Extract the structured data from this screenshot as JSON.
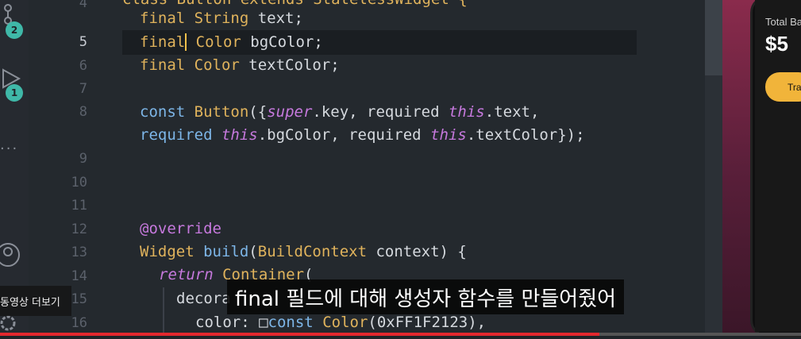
{
  "activity_bar": {
    "source_control_badge": "2",
    "run_badge": "1",
    "more_label": "..."
  },
  "line_numbers": [
    "4",
    "5",
    "6",
    "7",
    "8",
    "9",
    "10",
    "11",
    "12",
    "13",
    "14",
    "15",
    "16"
  ],
  "code": {
    "line4": {
      "kw": "final",
      "type": "String",
      "rest": " text;"
    },
    "line5": {
      "kw": "final",
      "type": "Color",
      "rest": " bgColor;"
    },
    "line6": {
      "kw": "final",
      "type": "Color",
      "rest": " textColor;"
    },
    "line8a": {
      "kw": "const",
      "cls": "Button",
      "p1": "({",
      "super": "super",
      "p2": ".key, required ",
      "this1": "this",
      "p3": ".text,"
    },
    "line8b": {
      "kw": "required ",
      "this2": "this",
      "p4": ".bgColor, required ",
      "this3": "this",
      "p5": ".textColor",
      "p6": "});"
    },
    "line12": {
      "ann": "@override"
    },
    "line13": {
      "type": "Widget",
      "fn": "build",
      "p1": "(",
      "type2": "BuildContext",
      "p2": " context) {"
    },
    "line14": {
      "kw": "return",
      "type": "Container",
      "p1": "("
    },
    "line15": {
      "text": "decora"
    },
    "line16": {
      "prop": "color: ",
      "swatch": "□",
      "kw": "const",
      "type": "Color",
      "p1": "(0xFF1F2123),"
    },
    "top_partial": "class Button extends StatelessWidget {"
  },
  "phone": {
    "total_label": "Total Ba",
    "amount": "$5",
    "button_label": "Tra"
  },
  "overlay": {
    "more_videos": "동영상 더보기",
    "subtitle": "final 필드에 대해 생성자 함수를 만들어줬어"
  }
}
